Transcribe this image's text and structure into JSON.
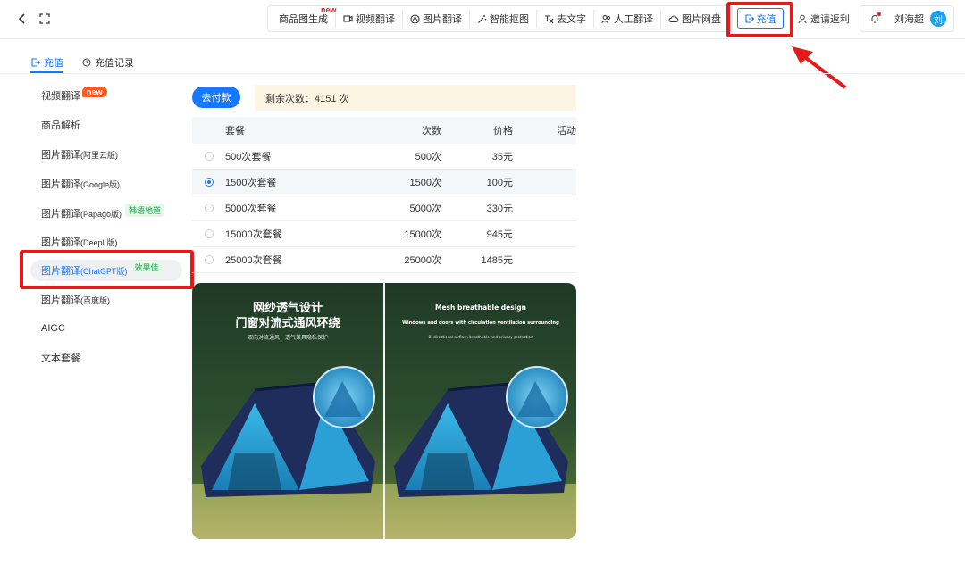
{
  "topbar": {
    "nav": [
      {
        "label": "商品图生成",
        "icon": "none"
      },
      {
        "label": "视频翻译",
        "icon": "video-icon"
      },
      {
        "label": "图片翻译",
        "icon": "image-translate-icon"
      },
      {
        "label": "智能抠图",
        "icon": "magic-wand-icon"
      },
      {
        "label": "去文字",
        "icon": "text-remove-icon"
      },
      {
        "label": "人工翻译",
        "icon": "people-icon"
      },
      {
        "label": "图片网盘",
        "icon": "cloud-icon"
      }
    ],
    "new_flag": "new",
    "recharge_label": "充值",
    "invite_label": "邀请返利",
    "username": "刘海超",
    "avatar_text": "刘"
  },
  "subtabs": [
    {
      "label": "充值",
      "active": true
    },
    {
      "label": "充值记录",
      "active": false
    }
  ],
  "sidebar": {
    "items": [
      {
        "label": "视频翻译",
        "suffix": "",
        "badge": "new"
      },
      {
        "label": "商品解析",
        "suffix": "",
        "badge": ""
      },
      {
        "label": "图片翻译",
        "suffix": "(阿里云版)",
        "badge": ""
      },
      {
        "label": "图片翻译",
        "suffix": "(Google版)",
        "badge": ""
      },
      {
        "label": "图片翻译",
        "suffix": "(Papago版)",
        "badge": "韩语地道"
      },
      {
        "label": "图片翻译",
        "suffix": "(DeepL版)",
        "badge": ""
      },
      {
        "label": "图片翻译",
        "suffix": "(ChatGPT版)",
        "badge": "效果佳"
      },
      {
        "label": "图片翻译",
        "suffix": "(百度版)",
        "badge": ""
      },
      {
        "label": "AIGC",
        "suffix": "",
        "badge": ""
      },
      {
        "label": "文本套餐",
        "suffix": "",
        "badge": ""
      }
    ],
    "active_index": 6
  },
  "main": {
    "pay_label": "去付款",
    "remaining_text": "剩余次数：4151 次",
    "table": {
      "headers": [
        "套餐",
        "次数",
        "价格",
        "活动"
      ],
      "rows": [
        {
          "name": "500次套餐",
          "count": "500次",
          "price": "35元",
          "selected": false
        },
        {
          "name": "1500次套餐",
          "count": "1500次",
          "price": "100元",
          "selected": true
        },
        {
          "name": "5000次套餐",
          "count": "5000次",
          "price": "330元",
          "selected": false
        },
        {
          "name": "15000次套餐",
          "count": "15000次",
          "price": "945元",
          "selected": false
        },
        {
          "name": "25000次套餐",
          "count": "25000次",
          "price": "1485元",
          "selected": false
        }
      ]
    },
    "promo": {
      "left_title_1": "网纱透气设计",
      "left_title_2": "门窗对流式通风环绕",
      "left_sub": "双向对流通风，透气兼具隐私保护",
      "right_title_1": "Mesh breathable design",
      "right_title_2": "Windows and doors with circulation ventilation surrounding",
      "right_sub": "Bi-directional airflow, breathable and privacy protection"
    }
  },
  "colors": {
    "accent": "#1677ff",
    "highlight_red": "#e51b1b",
    "new_badge": "#ff5a1f",
    "notice_bg": "#fdf5e4"
  }
}
